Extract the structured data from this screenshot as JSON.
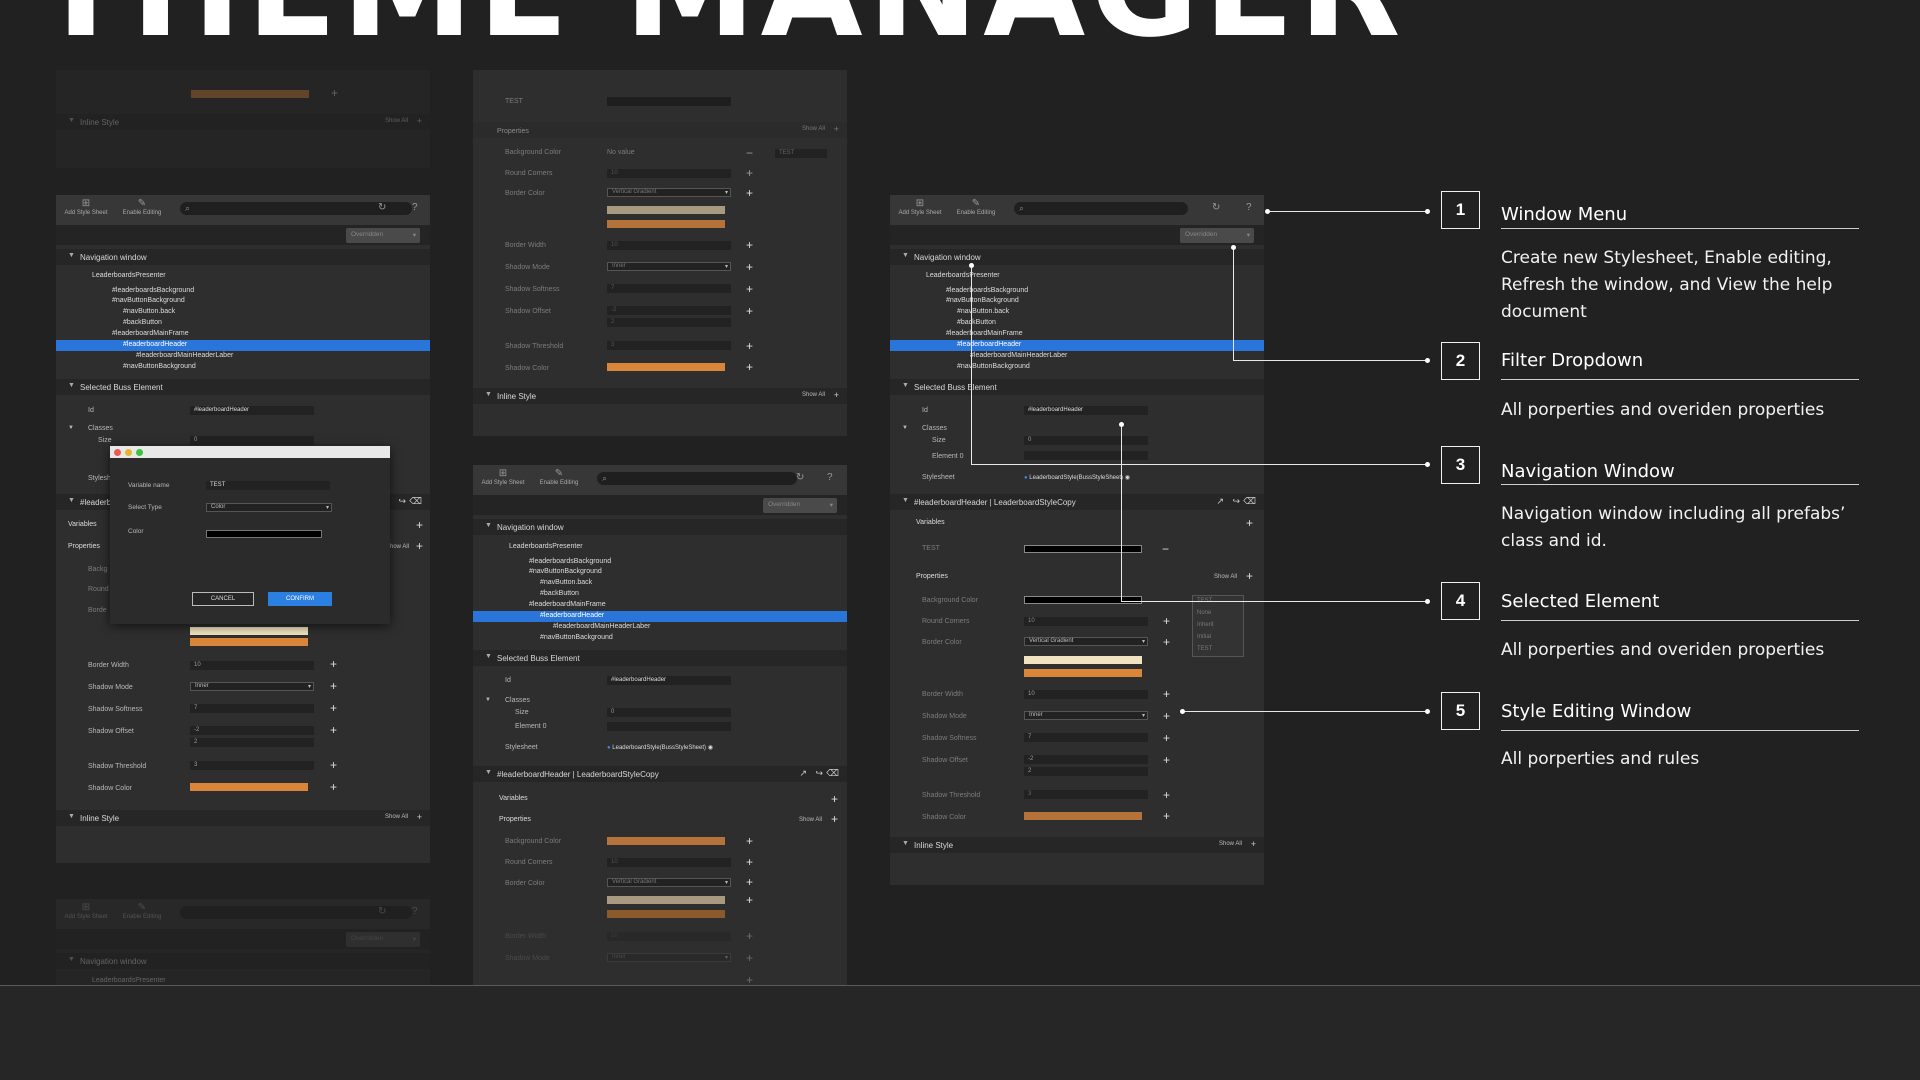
{
  "page": {
    "title": "THEME MANAGER"
  },
  "app": {
    "toolbar": {
      "add_style_sheet": "Add Style Sheet",
      "enable_editing": "Enable Editing",
      "filter_value": "Overridden"
    },
    "navigation": {
      "heading": "Navigation window",
      "items": [
        "LeaderboardsPresenter",
        "#leaderboardsBackground",
        "#navButtonBackground",
        "#navButton.back",
        "#backButton",
        "#leaderboardMainFrame",
        "#leaderboardHeader",
        "#leaderboardMainHeaderLaber",
        "#navButtonBackground"
      ]
    },
    "selected": {
      "heading": "Selected Buss Element",
      "id_label": "Id",
      "id_value": "#leaderboardHeader",
      "classes_label": "Classes",
      "size_label": "Size",
      "size_value": "0",
      "element_label": "Element 0",
      "stylesheet_label": "Stylesheet",
      "stylesheet_value": "LeaderboardStyle(BussStyleSheet)"
    },
    "style": {
      "header_left": "#leaderboardHeader",
      "header_right": "LeaderboardStyleCopy",
      "variables_label": "Variables",
      "test_label": "TEST",
      "properties_label": "Properties",
      "show_all": "Show All",
      "background_color": "Background Color",
      "no_value": "No value",
      "round_corners": "Round Corners",
      "round_corners_value": "10",
      "border_color": "Border Color",
      "border_color_value": "Vertical Gradient",
      "border_width": "Border Width",
      "border_width_value": "10",
      "shadow_mode": "Shadow Mode",
      "shadow_mode_value": "Inner",
      "shadow_softness": "Shadow Softness",
      "shadow_softness_value": "7",
      "shadow_offset": "Shadow Offset",
      "shadow_offset_x": "-2",
      "shadow_offset_y": "2",
      "shadow_threshold": "Shadow Threshold",
      "shadow_threshold_value": "3",
      "shadow_color": "Shadow Color",
      "inline_style": "Inline Style",
      "test_dd": "TEST",
      "dropdown_options": [
        "TEST",
        "None",
        "Inherit",
        "Initial",
        "TEST"
      ]
    },
    "dialog": {
      "variable_name_label": "Variable name",
      "variable_name_value": "TEST",
      "select_type_label": "Select Type",
      "select_type_value": "Color",
      "color_label": "Color",
      "cancel": "CANCEL",
      "confirm": "CONFIRM"
    },
    "colors": {
      "selection": "#2a75d9",
      "orange": "#d9863a",
      "cream": "#f1e3bf",
      "tan": "#a89a80",
      "brown": "#b5723a"
    }
  },
  "legend": [
    {
      "num": "1",
      "title": "Window Menu",
      "desc": "Create new Stylesheet, Enable editing, Refresh the window, and View the help document"
    },
    {
      "num": "2",
      "title": "Filter Dropdown",
      "desc": "All porperties and overiden properties"
    },
    {
      "num": "3",
      "title": "Navigation Window",
      "desc": "Navigation window including all prefabs’ class and id."
    },
    {
      "num": "4",
      "title": "Selected Element",
      "desc": "All porperties and overiden properties"
    },
    {
      "num": "5",
      "title": "Style Editing Window",
      "desc": "All porperties and rules"
    }
  ]
}
